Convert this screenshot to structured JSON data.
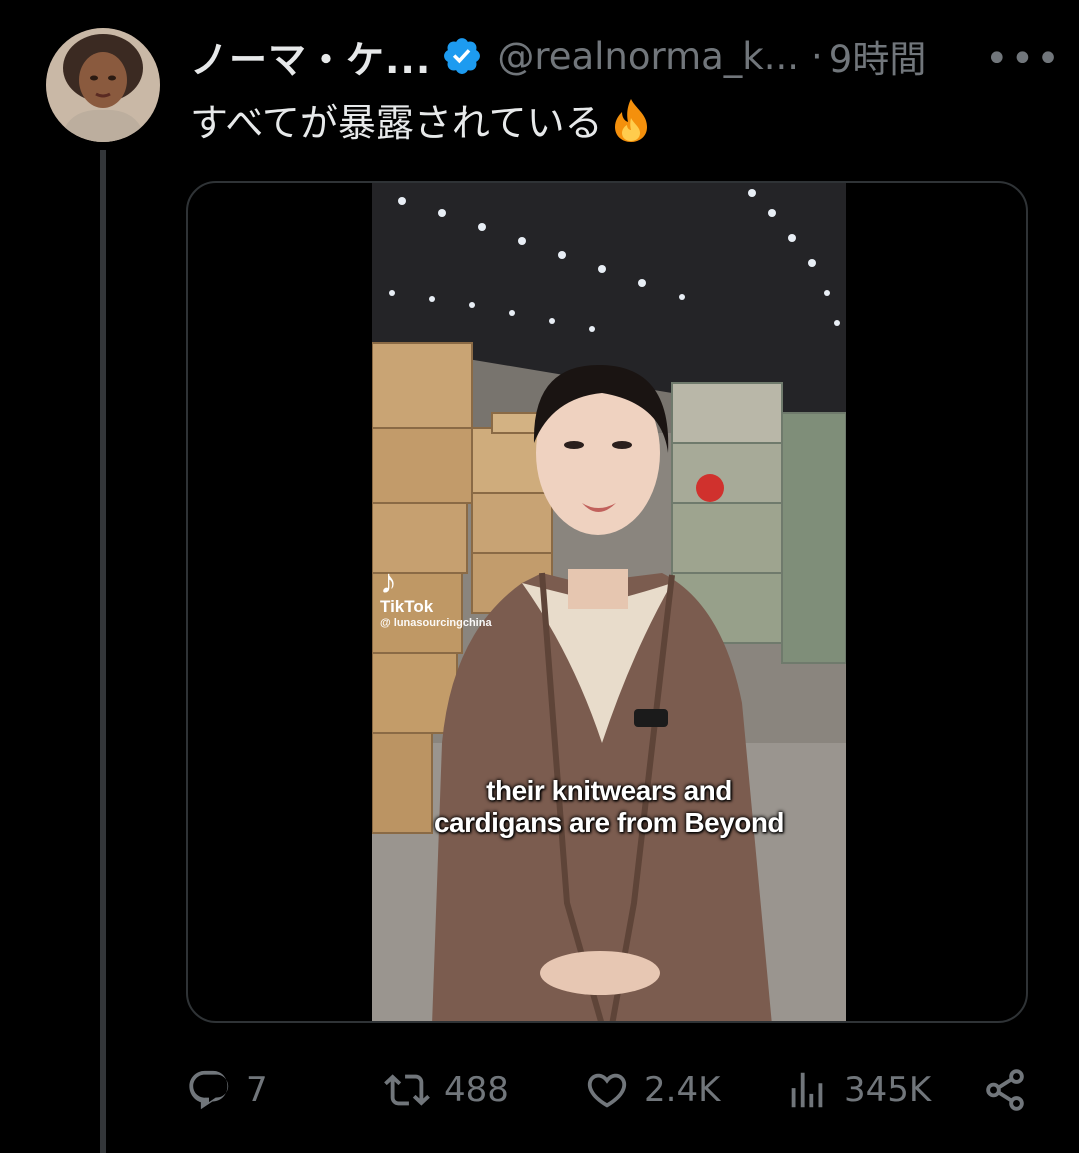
{
  "tweet": {
    "author_name": "ノーマ・ケ...",
    "handle": "@realnorma_k...",
    "separator": "·",
    "time": "9時間",
    "more_label": "•••",
    "text": "すべてが暴露されている",
    "emoji": "fire-emoji"
  },
  "media": {
    "watermark_brand": "TikTok",
    "watermark_user": "@ lunasourcingchina",
    "caption_line1": "their knitwears and",
    "caption_line2": "cardigans are from Beyond"
  },
  "actions": {
    "replies": "7",
    "retweets": "488",
    "likes": "2.4K",
    "views": "345K"
  },
  "colors": {
    "background": "#000000",
    "text_primary": "#e7e9ea",
    "text_secondary": "#71767b",
    "verified_blue": "#1d9bf0",
    "border": "#2f3336"
  },
  "icons": [
    "verified-badge-icon",
    "more-icon",
    "reply-icon",
    "retweet-icon",
    "like-icon",
    "views-icon",
    "share-icon",
    "tiktok-logo-icon"
  ]
}
